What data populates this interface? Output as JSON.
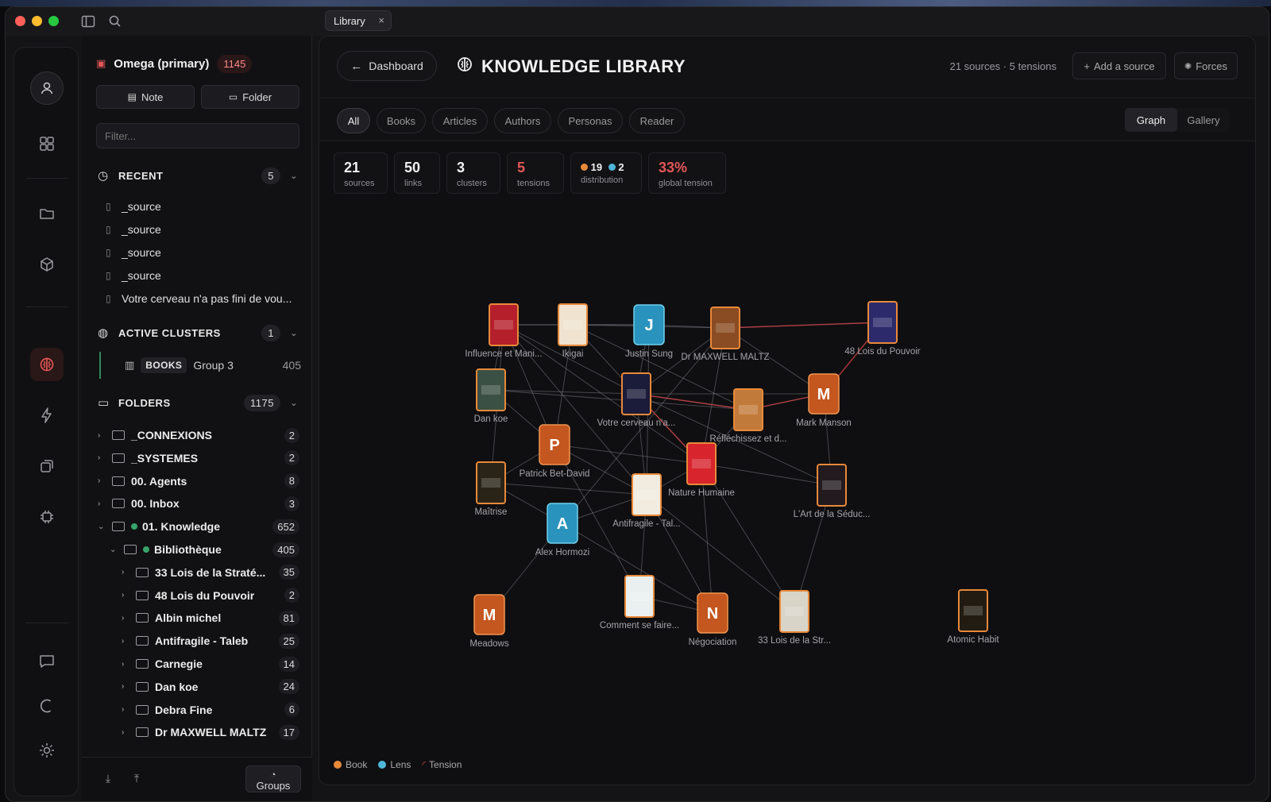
{
  "window": {
    "tab_title": "Library",
    "tab_close": "×"
  },
  "sidebar": {
    "workspace_name": "Omega (primary)",
    "workspace_count": "1145",
    "note_label": "Note",
    "folder_label": "Folder",
    "filter_placeholder": "Filter...",
    "recent": {
      "title": "RECENT",
      "count": "5",
      "items": [
        "_source",
        "_source",
        "_source",
        "_source",
        "Votre cerveau n'a pas fini de vou..."
      ]
    },
    "clusters": {
      "title": "ACTIVE CLUSTERS",
      "count": "1",
      "item": {
        "tag": "BOOKS",
        "name": "Group 3",
        "count": "405"
      }
    },
    "folders": {
      "title": "FOLDERS",
      "count": "1175",
      "items": [
        {
          "name": "_CONNEXIONS",
          "count": "2"
        },
        {
          "name": "_SYSTEMES",
          "count": "2"
        },
        {
          "name": "00. Agents",
          "count": "8"
        },
        {
          "name": "00. Inbox",
          "count": "3"
        },
        {
          "name": "01. Knowledge",
          "count": "652"
        },
        {
          "name": "Bibliothèque",
          "count": "405"
        },
        {
          "name": "33 Lois de la Straté...",
          "count": "35"
        },
        {
          "name": "48 Lois du Pouvoir",
          "count": "2"
        },
        {
          "name": "Albin michel",
          "count": "81"
        },
        {
          "name": "Antifragile - Taleb",
          "count": "25"
        },
        {
          "name": "Carnegie",
          "count": "14"
        },
        {
          "name": "Dan koe",
          "count": "24"
        },
        {
          "name": "Debra Fine",
          "count": "6"
        },
        {
          "name": "Dr MAXWELL MALTZ",
          "count": "17"
        }
      ]
    },
    "groups_label": "Groups"
  },
  "header": {
    "back_label": "Dashboard",
    "title": "KNOWLEDGE LIBRARY",
    "meta": "21 sources · 5 tensions",
    "add_source": "Add a source",
    "forces": "Forces"
  },
  "filters": {
    "chips": [
      "All",
      "Books",
      "Articles",
      "Authors",
      "Personas",
      "Reader"
    ],
    "active": "All",
    "views": [
      "Graph",
      "Gallery"
    ],
    "active_view": "Graph"
  },
  "stats": {
    "sources": {
      "value": "21",
      "label": "sources"
    },
    "links": {
      "value": "50",
      "label": "links"
    },
    "clusters": {
      "value": "3",
      "label": "clusters"
    },
    "tensions": {
      "value": "5",
      "label": "tensions"
    },
    "distribution": {
      "book": "19",
      "lens": "2",
      "label": "distribution"
    },
    "global_tension": {
      "value": "33%",
      "label": "global tension"
    }
  },
  "colors": {
    "book": "#e8893a",
    "lens": "#4fb6d8",
    "tension": "#d9434a",
    "accent_red": "#e35656"
  },
  "graph": {
    "nodes": [
      {
        "label": "Influence et Mani..."
      },
      {
        "label": "Ikigai"
      },
      {
        "label": "Justin Sung",
        "letter": "J"
      },
      {
        "label": "Dr MAXWELL MALTZ"
      },
      {
        "label": "48 Lois du Pouvoir"
      },
      {
        "label": "Dan koe"
      },
      {
        "label": "Votre cerveau n'a..."
      },
      {
        "label": "Réfléchissez et d..."
      },
      {
        "label": "Mark Manson",
        "letter": "M"
      },
      {
        "label": "Patrick Bet-David",
        "letter": "P"
      },
      {
        "label": "Maîtrise"
      },
      {
        "label": "Nature Humaine"
      },
      {
        "label": "L'Art de la Séduc..."
      },
      {
        "label": "Alex Hormozi",
        "letter": "A"
      },
      {
        "label": "Antifragile - Tal..."
      },
      {
        "label": "Meadows",
        "letter": "M"
      },
      {
        "label": "Comment se faire..."
      },
      {
        "label": "Négociation",
        "letter": "N"
      },
      {
        "label": "33 Lois de la Str..."
      },
      {
        "label": "Atomic Habit"
      }
    ]
  },
  "legend": {
    "book": "Book",
    "lens": "Lens",
    "tension": "Tension"
  }
}
